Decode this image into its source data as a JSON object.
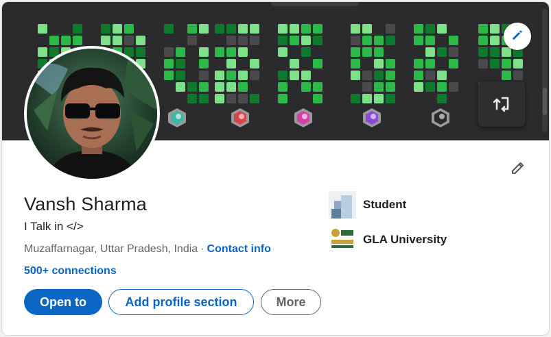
{
  "profile": {
    "name": "Vansh Sharma",
    "headline": "I Talk in </>",
    "location": "Muzaffarnagar, Uttar Pradesh, India",
    "separator": "·",
    "contact_info_label": "Contact info",
    "connections": "500+ connections"
  },
  "actions": {
    "open_to_label": "Open to",
    "add_section_label": "Add profile section",
    "more_label": "More"
  },
  "experience": [
    {
      "label": "Student",
      "icon": "company-logo-icon"
    },
    {
      "label": "GLA University",
      "icon": "university-logo-icon"
    }
  ],
  "banner": {
    "description_icons": [
      "pencil-icon",
      "share-icon"
    ],
    "colors": {
      "background": "#2b2b2d",
      "green_dark": "#0f7a2e",
      "green_mid": "#2db84a",
      "green_light": "#7fe08a",
      "grey": "#4a4a4c"
    }
  },
  "colors": {
    "brand": "#0a66c2",
    "text": "#1f1f1f",
    "muted": "#666666"
  }
}
